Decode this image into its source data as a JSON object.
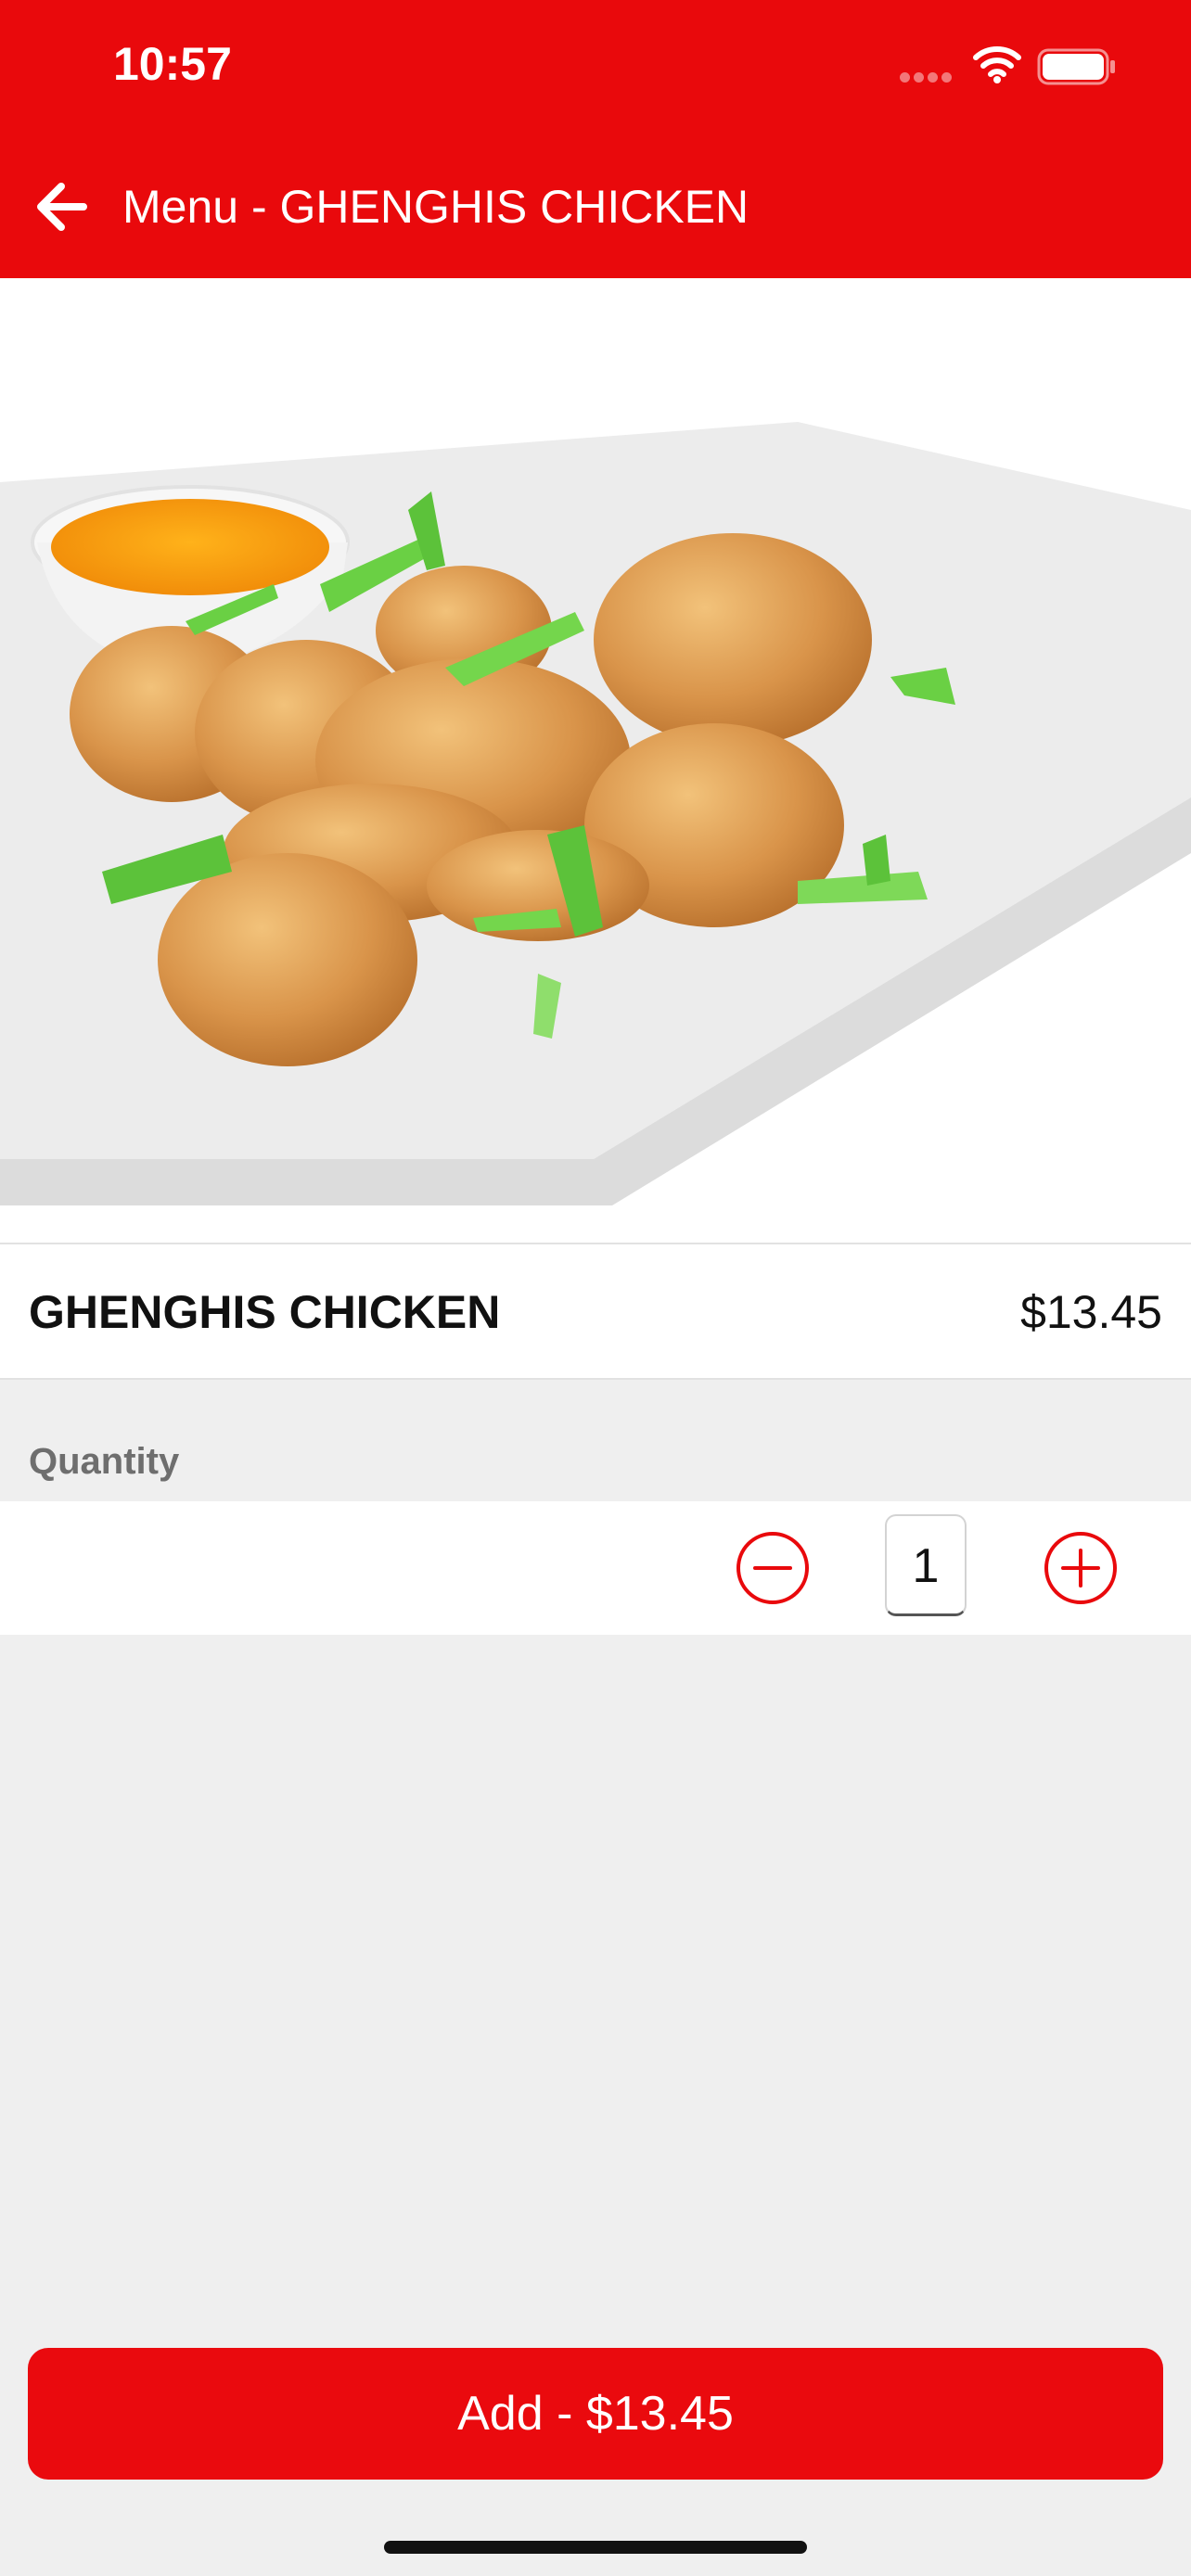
{
  "status_bar": {
    "time": "10:57"
  },
  "header": {
    "title": "Menu - GHENGHIS CHICKEN"
  },
  "item": {
    "name": "GHENGHIS CHICKEN",
    "price": "$13.45"
  },
  "quantity": {
    "label": "Quantity",
    "value": "1"
  },
  "add_button": {
    "label": "Add - $13.45"
  },
  "colors": {
    "brand_red": "#e9090c",
    "background": "#efefef"
  },
  "icons": [
    "back-arrow-icon",
    "minus-circle-icon",
    "plus-circle-icon",
    "wifi-icon",
    "battery-icon",
    "signal-icon"
  ]
}
